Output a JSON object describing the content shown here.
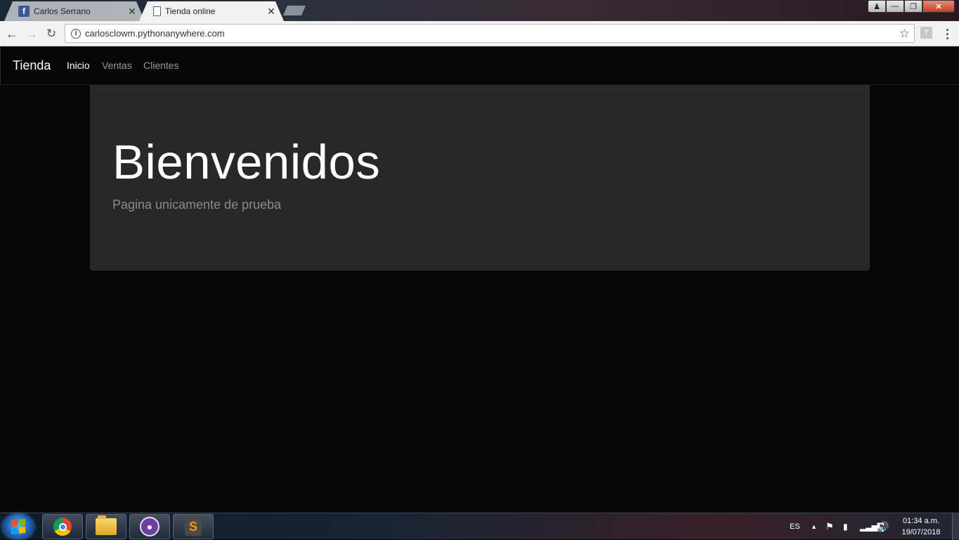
{
  "browser": {
    "tabs": [
      {
        "title": "Carlos Serrano",
        "icon": "facebook-icon",
        "close": "✕"
      },
      {
        "title": "Tienda online",
        "icon": "document-icon",
        "close": "✕"
      }
    ],
    "url": "carlosclowm.pythonanywhere.com",
    "extension_letter": "T"
  },
  "site": {
    "brand": "Tienda",
    "nav": [
      {
        "label": "Inicio",
        "active": true
      },
      {
        "label": "Ventas",
        "active": false
      },
      {
        "label": "Clientes",
        "active": false
      }
    ]
  },
  "jumbotron": {
    "title": "Bienvenidos",
    "lead": "Pagina unicamente de prueba"
  },
  "taskbar": {
    "apps": [
      "chrome-icon",
      "file-explorer-icon",
      "github-desktop-icon",
      "sublime-text-icon"
    ],
    "language": "ES",
    "time": "01:34 a.m.",
    "date": "19/07/2018"
  },
  "colors": {
    "page_background": "#060606",
    "jumbotron_background": "#282828",
    "nav_active": "#ffffff",
    "nav_inactive": "#9a9a9a"
  }
}
